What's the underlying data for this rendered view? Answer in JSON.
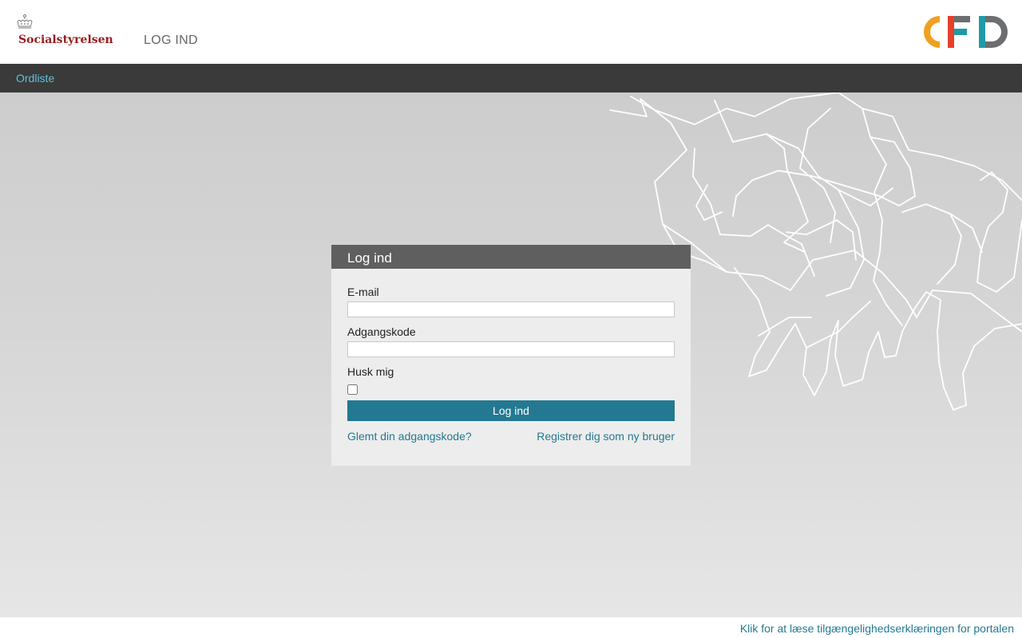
{
  "header": {
    "brand": "Socialstyrelsen",
    "title": "LOG IND",
    "partner_logo": "CFD"
  },
  "nav": {
    "items": [
      {
        "label": "Ordliste"
      }
    ]
  },
  "login": {
    "heading": "Log ind",
    "email_label": "E-mail",
    "email_value": "",
    "password_label": "Adgangskode",
    "password_value": "",
    "remember_label": "Husk mig",
    "remember_checked": false,
    "submit_label": "Log ind",
    "forgot_link": "Glemt din adgangskode?",
    "register_link": "Registrer dig som ny bruger"
  },
  "footer": {
    "accessibility_link": "Klik for at læse tilgængelighedserklæringen for portalen"
  },
  "colors": {
    "brand_red": "#9b1c1f",
    "nav_bg": "#3a3a3a",
    "nav_link": "#5ec0e0",
    "panel_header": "#5f5f5f",
    "accent_teal": "#237991",
    "cfd_orange": "#f0a020",
    "cfd_red": "#e5402a",
    "cfd_teal": "#1f9aa8",
    "cfd_gray": "#6d6e70"
  },
  "icons": [
    "crown-icon",
    "socialstyrelsen-logo",
    "cfd-logo",
    "hands-illustration"
  ]
}
